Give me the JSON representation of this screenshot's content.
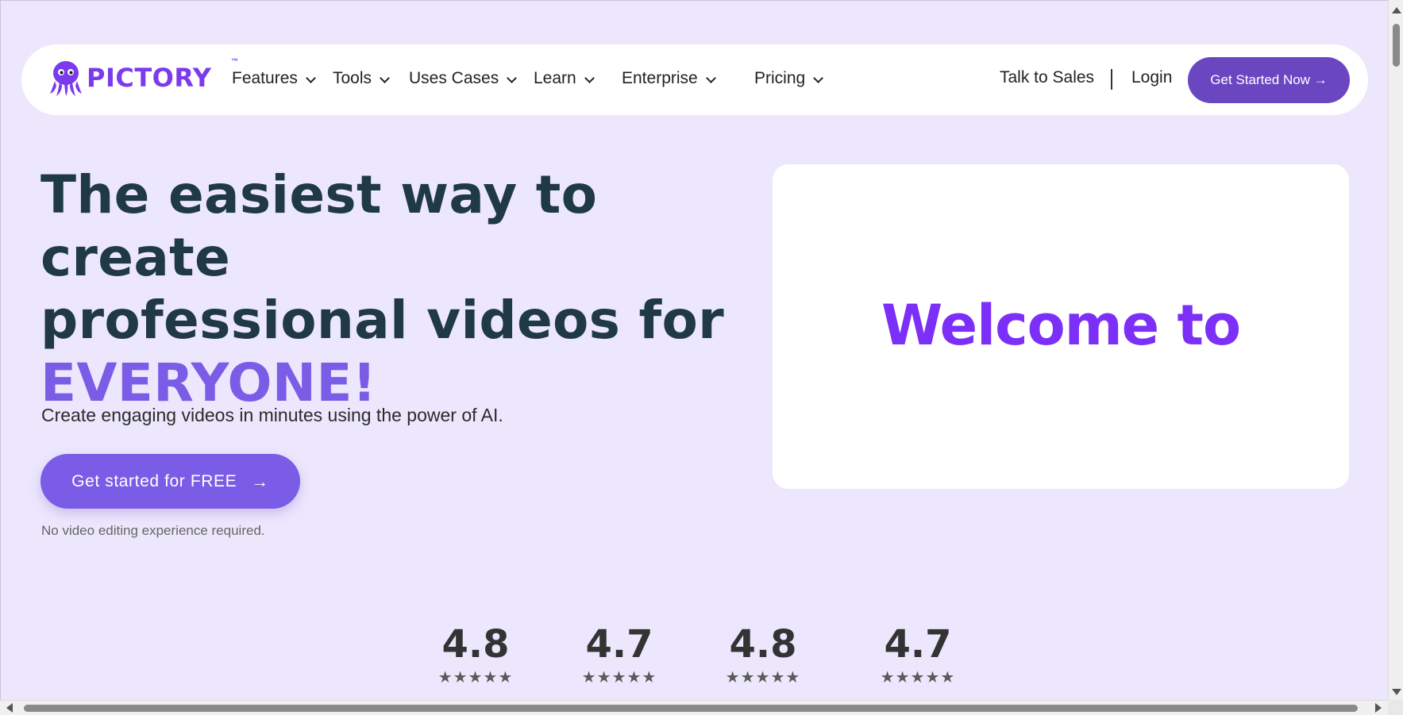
{
  "brand": {
    "name": "PICTORY",
    "tm": "™",
    "color": "#7c3aed"
  },
  "nav": {
    "items": [
      {
        "label": "Features"
      },
      {
        "label": "Tools"
      },
      {
        "label": "Uses Cases"
      },
      {
        "label": "Learn"
      },
      {
        "label": "Enterprise"
      },
      {
        "label": "Pricing"
      }
    ],
    "talk_to_sales": "Talk to Sales",
    "login": "Login",
    "cta": "Get Started Now →"
  },
  "hero": {
    "title_line1": "The easiest way to create",
    "title_line2": "professional videos for",
    "title_accent": "EVERYONE!",
    "subtitle": "Create engaging videos in minutes using the power of AI.",
    "cta": "Get started for FREE",
    "cta_arrow": "→",
    "note": "No video editing experience required."
  },
  "video": {
    "text": "Welcome to"
  },
  "ratings": [
    {
      "score": "4.8",
      "stars": "★★★★★"
    },
    {
      "score": "4.7",
      "stars": "★★★★★"
    },
    {
      "score": "4.8",
      "stars": "★★★★★"
    },
    {
      "score": "4.7",
      "stars": "★★★★★"
    }
  ],
  "colors": {
    "background": "#ece7fd",
    "accent": "#7b5ce6",
    "button_dark": "#6b46c1",
    "heading": "#1f3a44"
  }
}
